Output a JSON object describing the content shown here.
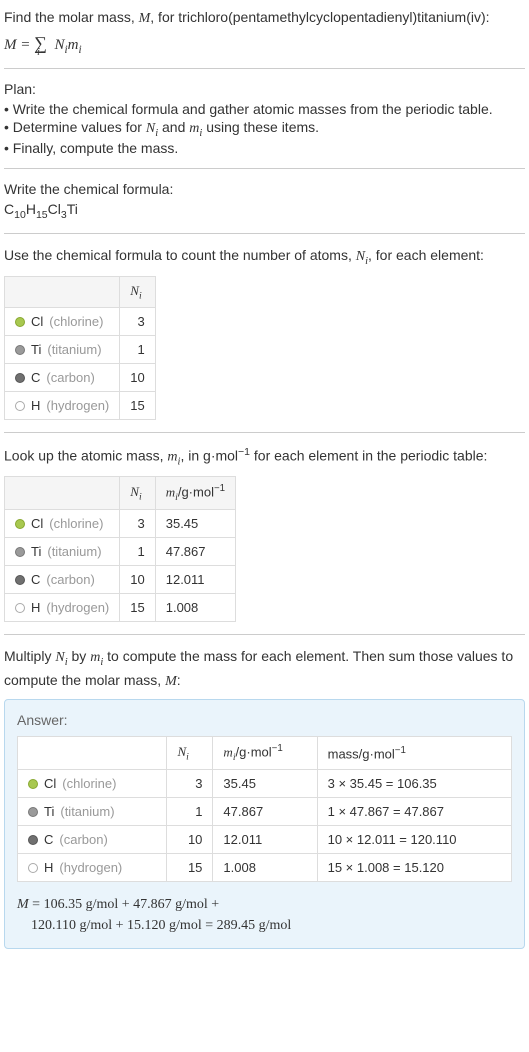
{
  "intro": {
    "line1": "Find the molar mass, M, for trichloro(pentamethylcyclopentadienyl)titanium(iv):",
    "formula_M": "M",
    "formula_eq": " = ",
    "formula_sum": "∑",
    "formula_sub": "i",
    "formula_rest": " N",
    "formula_i1": "i",
    "formula_m": "m",
    "formula_i2": "i"
  },
  "plan": {
    "title": "Plan:",
    "item1": "• Write the chemical formula and gather atomic masses from the periodic table.",
    "item2_a": "• Determine values for ",
    "item2_N": "N",
    "item2_i1": "i",
    "item2_and": " and ",
    "item2_m": "m",
    "item2_i2": "i",
    "item2_b": " using these items.",
    "item3": "• Finally, compute the mass."
  },
  "chem": {
    "title": "Write the chemical formula:",
    "C": "C",
    "s10": "10",
    "H": "H",
    "s15": "15",
    "Cl": "Cl",
    "s3": "3",
    "Ti": "Ti"
  },
  "count": {
    "intro_a": "Use the chemical formula to count the number of atoms, ",
    "intro_N": "N",
    "intro_i": "i",
    "intro_b": ", for each element:",
    "header_N": "N",
    "header_i": "i"
  },
  "elements": [
    {
      "sym": "Cl",
      "name": "(chlorine)",
      "color": "#a8c850",
      "N": "3",
      "m": "35.45",
      "mass": "3 × 35.45 = 106.35"
    },
    {
      "sym": "Ti",
      "name": "(titanium)",
      "color": "#9a9a9a",
      "N": "1",
      "m": "47.867",
      "mass": "1 × 47.867 = 47.867"
    },
    {
      "sym": "C",
      "name": "(carbon)",
      "color": "#707070",
      "N": "10",
      "m": "12.011",
      "mass": "10 × 12.011 = 120.110"
    },
    {
      "sym": "H",
      "name": "(hydrogen)",
      "color": "#ffffff",
      "N": "15",
      "m": "1.008",
      "mass": "15 × 1.008 = 15.120"
    }
  ],
  "lookup": {
    "intro_a": "Look up the atomic mass, ",
    "intro_m": "m",
    "intro_i": "i",
    "intro_b": ", in g·mol",
    "intro_sup": "−1",
    "intro_c": " for each element in the periodic table:",
    "header_N": "N",
    "header_Ni": "i",
    "header_m": "m",
    "header_mi": "i",
    "header_unit": "/g·mol",
    "header_sup": "−1"
  },
  "multiply": {
    "intro_a": "Multiply ",
    "intro_N": "N",
    "intro_i1": "i",
    "intro_by": " by ",
    "intro_m": "m",
    "intro_i2": "i",
    "intro_b": " to compute the mass for each element. Then sum those values to compute the molar mass, ",
    "intro_M": "M",
    "intro_c": ":"
  },
  "answer": {
    "label": "Answer:",
    "header_N": "N",
    "header_Ni": "i",
    "header_m": "m",
    "header_mi": "i",
    "header_unit": "/g·mol",
    "header_sup": "−1",
    "header_mass": "mass/g·mol",
    "header_mass_sup": "−1",
    "final_M": "M",
    "final_eq": " = 106.35 g/mol + 47.867 g/mol +",
    "final_line2": "120.110 g/mol + 15.120 g/mol = 289.45 g/mol"
  }
}
